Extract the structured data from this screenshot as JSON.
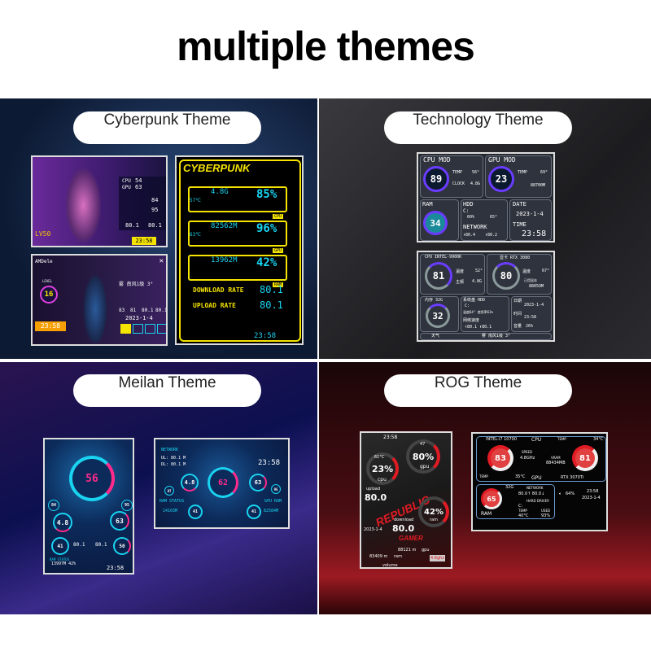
{
  "title": "multiple themes",
  "themes": [
    {
      "label": "Cyberpunk Theme",
      "screen1": {
        "cpu_label": "CPU",
        "cpu": "54",
        "gpu_label": "GPU",
        "gpu": "63",
        "v1": "84",
        "v2": "95",
        "net1": "80.1",
        "net2": "80.1",
        "level": "LV50",
        "time": "23:58"
      },
      "screen2": {
        "name": "AMDele",
        "level_label": "LEVEL",
        "level": "16",
        "time": "23:58",
        "weather": "雾 南风1级 3°",
        "cpu": "83",
        "gpu": "81",
        "net1": "80.1",
        "net2": "80.1",
        "date": "2023-1-4"
      },
      "screen3": {
        "logo": "CYBERPUNK",
        "rows": [
          {
            "temp": "57℃",
            "value": "4.8G",
            "pct": "85%",
            "tag": "CPU"
          },
          {
            "temp": "63℃",
            "value": "82562M",
            "pct": "96%",
            "tag": "GPU"
          },
          {
            "temp": "",
            "value": "13962M",
            "pct": "42%",
            "tag": "RAM"
          }
        ],
        "download_label": "DOWNLOAD RATE",
        "download": "80.1",
        "upload_label": "UPLOAD RATE",
        "upload": "80.1",
        "time": "23:58"
      }
    },
    {
      "label": "Technology Theme",
      "screen1": {
        "cpu_title": "CPU MOD",
        "cpu": "89",
        "cpu_unit": "CPU %",
        "cpu_temp_label": "TEMP",
        "cpu_temp": "56°",
        "clock_label": "CLOCK",
        "clock": "4.8G",
        "gpu_title": "GPU MOD",
        "gpu": "23",
        "gpu_unit": "GPU %",
        "gpu_temp_label": "TEMP",
        "gpu_temp": "69°",
        "gpu_mem": "88700M",
        "ram_title": "RAM",
        "ram": "34",
        "ram_unit": "RAM %",
        "hdd_title": "HDD",
        "hdd_drive": "C:",
        "hdd_pct": "60%",
        "hdd_temp": "65°",
        "net_title": "NETWORK",
        "down": "⬇80.4",
        "up": "⬆80.2",
        "date_title": "DATE",
        "date": "2023-1-4",
        "time_title": "TIME",
        "time": "23:58"
      },
      "screen2": {
        "cpu_title": "CPU INTEL-9900K",
        "cpu": "81",
        "cpu_unit": "使用率 %",
        "cpu_temp_label": "温度",
        "cpu_temp": "52°",
        "freq_label": "主频",
        "freq": "4.8G",
        "gpu_title": "显卡 RTX 3080",
        "gpu": "80",
        "gpu_unit": "使用率 %",
        "gpu_temp_label": "温度",
        "gpu_temp": "67°",
        "gpu_mem_label": "已用显存",
        "gpu_mem": "8805OM",
        "ram_title": "内存 32G",
        "ram": "32",
        "ram_unit": "使用率 %",
        "hdd_title": "系统盘 HDD",
        "hdd_drive": "C:",
        "hdd_info": "温度64° 使用率61%",
        "net_title": "网络速度",
        "net": "⬇80.1 ⬆80.1",
        "date_label": "日期",
        "date": "2023-1-4",
        "time_label": "时间",
        "time": "23:58",
        "vol_label": "音量",
        "vol": "26%",
        "weather_label": "天气",
        "weather": "雾 南风1级 3°"
      }
    },
    {
      "label": "Meilan Theme",
      "screen1": {
        "center": "56",
        "left_small": "84",
        "right_small": "95",
        "left_gauge": "4.8",
        "right_gauge": "63",
        "g1": "41",
        "g2": "50",
        "net1": "80.1",
        "net2": "80.1",
        "ram_label": "RAM STATUS",
        "ram": "13997M 42%",
        "time": "23:58"
      },
      "screen2": {
        "net_label": "NETWORK",
        "ul": "UL: 80.1 M",
        "dl": "DL: 80.1 M",
        "time": "23:58",
        "center": "62",
        "left_gauge": "4.8",
        "left_small": "87",
        "right_gauge": "63",
        "right_small": "95",
        "ram_label": "RAM STATUS",
        "ram": "14103M",
        "gpu_ram_label": "GPU RAM",
        "gpu_ram": "82584M",
        "g1": "41",
        "g2": "41"
      }
    },
    {
      "label": "ROG Theme",
      "screen1": {
        "time": "23:58",
        "cpu_temp": "61°C",
        "cpu": "23%",
        "cpu_label": "cpu",
        "gpu_temp": "47",
        "gpu": "80%",
        "gpu_label": "gpu",
        "brand": "REPUBLIC",
        "upload_label": "upload",
        "upload": "80.0",
        "download_label": "download",
        "download": "80.0",
        "ram": "42%",
        "ram_label": "ram",
        "date": "2023-1-4",
        "gamer": "GAMER",
        "gpu_mem": "88121 m",
        "gpu_mem_label": "gpu",
        "ram_mem": "83409 m",
        "ram_mem_label": "ram",
        "freq": "4.8ghz",
        "volume": "volume"
      },
      "screen2": {
        "cpu_name": "INTEL-i7 10700",
        "cpu_tag": "CPU",
        "temp_label": "TEMP",
        "gpu_temp": "34°C",
        "cpu_load": "83",
        "speed_label": "SPEED",
        "speed": "4.8GHz",
        "vram_label": "VRAM",
        "vram": "88434MB",
        "gpu_load": "81",
        "cpu_temp": "35°C",
        "gpu_tag": "GPU",
        "gpu_name": "RTX 3070Ti",
        "ram_size": "32G",
        "ram_load": "65",
        "ram_tag": "RAM",
        "net_label": "NETWORK",
        "net": "80.0↑ 80.0↓",
        "hdd_label": "HARD DRIVER",
        "hdd": "C:",
        "hdd_temp_label": "TEMP",
        "hdd_temp": "40°C",
        "used_label": "USED",
        "used": "93%",
        "vol": "64%",
        "time": "23:58",
        "date": "2023-1-4"
      }
    }
  ],
  "colors": {
    "cyber_yellow": "#f5e400",
    "cyber_cyan": "#19d3f0",
    "tech_purple": "#6a3cff",
    "meilan_pink": "#ff2a8a",
    "rog_red": "#e01b24"
  }
}
